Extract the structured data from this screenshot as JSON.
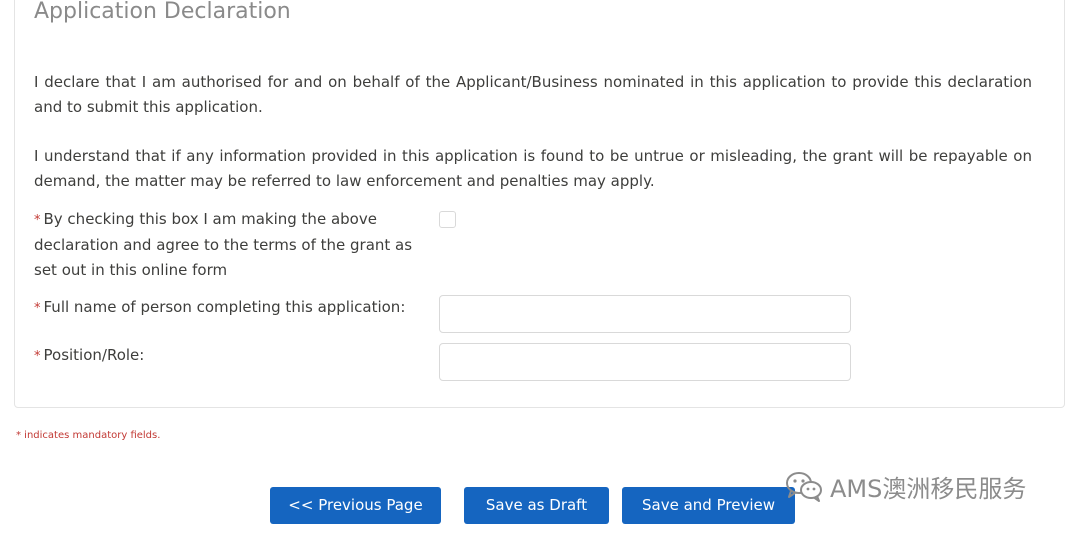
{
  "section": {
    "title": "Application Declaration",
    "paragraphs": [
      "I declare that I am authorised for and on behalf of the Applicant/Business nominated in this application to provide this declaration and to submit this application.",
      "I understand that if any information provided in this application is found to be untrue or misleading, the grant will be repayable on demand, the matter may be referred to law enforcement and penalties may apply."
    ]
  },
  "form": {
    "required_marker": "*",
    "agree_checkbox": {
      "label": "By checking this box I am making the above declaration and agree to the terms of the grant as set out in this online form",
      "checked": false
    },
    "full_name": {
      "label": "Full name of person completing this application:",
      "value": ""
    },
    "position_role": {
      "label": "Position/Role:",
      "value": ""
    }
  },
  "mandatory_note": "* indicates mandatory fields.",
  "buttons": {
    "previous": "<< Previous Page",
    "save_draft": "Save as Draft",
    "save_preview": "Save and Preview"
  },
  "watermark": {
    "text": "AMS澳洲移民服务",
    "icon": "wechat-icon"
  },
  "colors": {
    "primary_button": "#1565c0",
    "required": "#c23934",
    "title": "#8a8a8a"
  }
}
